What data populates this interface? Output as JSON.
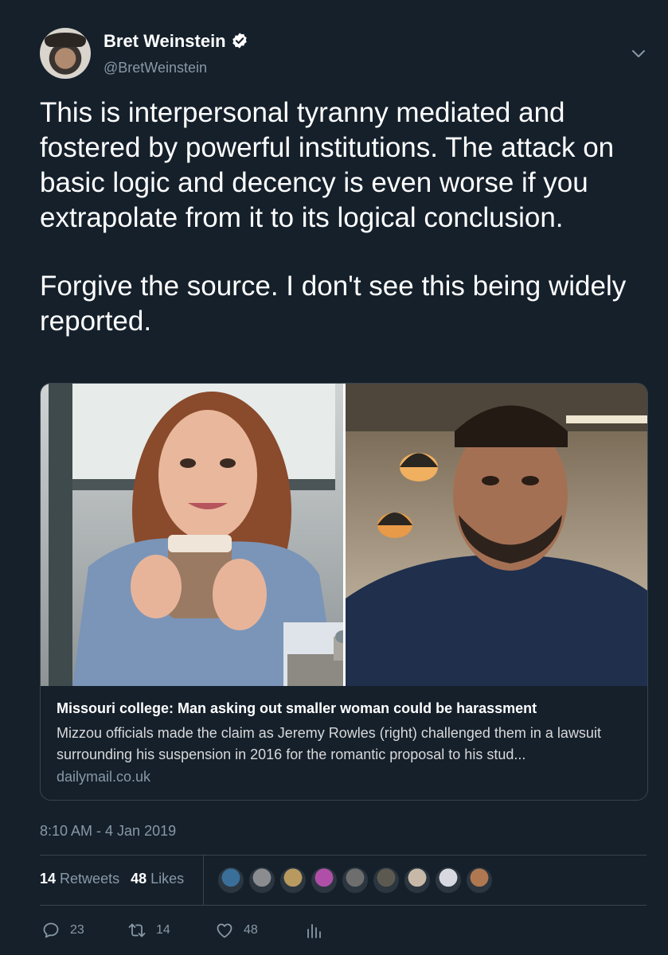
{
  "author": {
    "display_name": "Bret Weinstein",
    "handle": "@BretWeinstein",
    "verified": true
  },
  "tweet": {
    "paragraphs": [
      "This is interpersonal tyranny mediated and fostered by powerful institutions. The attack on basic logic and decency is even worse if you extrapolate from it to its logical conclusion.",
      "Forgive the source. I don't see this being widely reported."
    ],
    "timestamp": "8:10 AM - 4 Jan 2019"
  },
  "card": {
    "title": "Missouri college: Man asking out smaller woman could be harassment",
    "description": "Mizzou officials made the claim as Jeremy Rowles (right) challenged them in a lawsuit surrounding his suspension in 2016 for the romantic proposal to his stud...",
    "domain": "dailymail.co.uk"
  },
  "stats": {
    "retweets_count": "14",
    "retweets_label": "Retweets",
    "likes_count": "48",
    "likes_label": "Likes"
  },
  "liker_avatars": [
    "#3a6f9a",
    "#8a8c90",
    "#b89a60",
    "#b04fa8",
    "#6e6e6e",
    "#5c5a50",
    "#c8b8a8",
    "#d8d8e0",
    "#b07850"
  ],
  "actions": {
    "reply_count": "23",
    "retweet_count": "14",
    "like_count": "48"
  },
  "colors": {
    "background": "#15202b",
    "secondary_text": "#8899a6",
    "border": "#38444d",
    "verified_badge": "#ffffff"
  }
}
